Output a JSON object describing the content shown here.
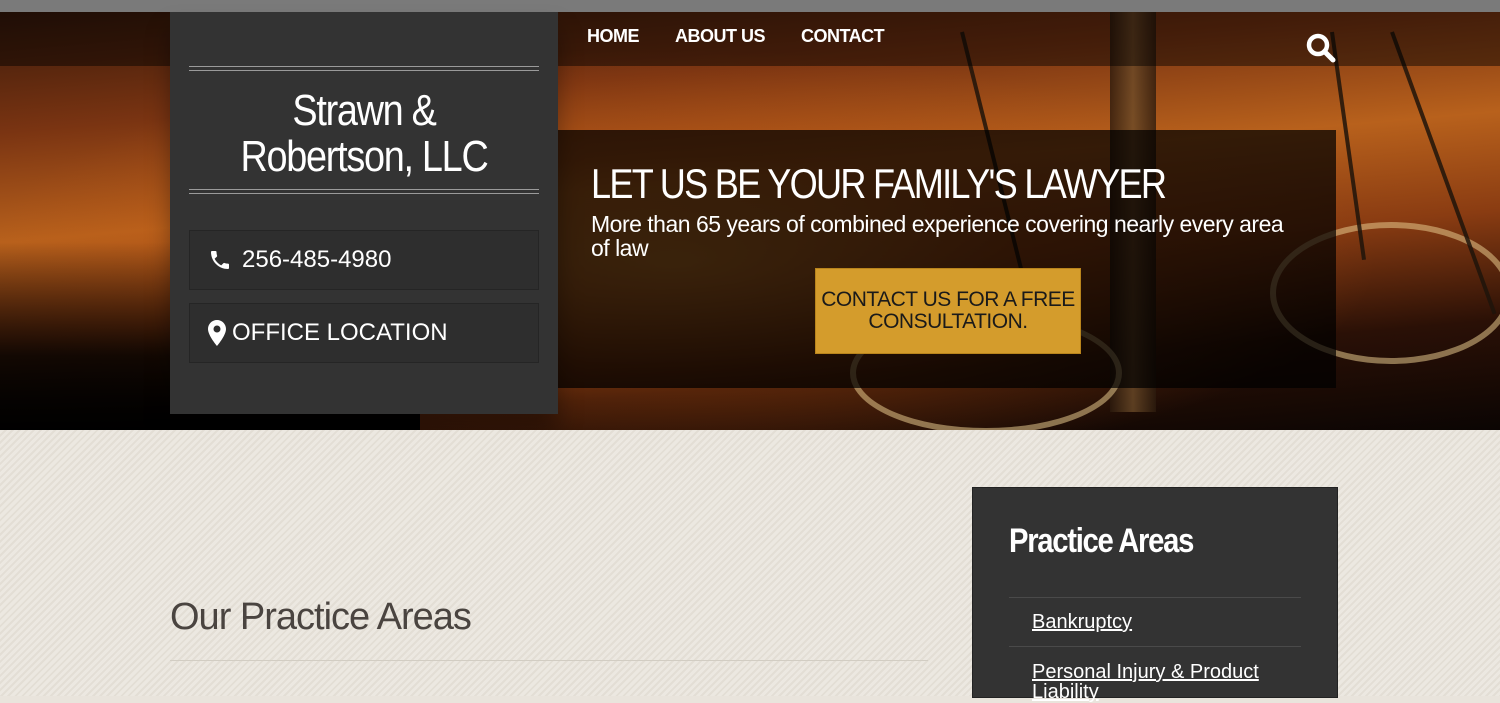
{
  "nav": {
    "items": [
      "HOME",
      "ABOUT US",
      "CONTACT"
    ]
  },
  "brand": {
    "name_line1": "Strawn &",
    "name_line2": "Robertson, LLC",
    "phone": "256-485-4980",
    "location_label": "OFFICE LOCATION"
  },
  "promo": {
    "headline": "LET US BE YOUR FAMILY'S LAWYER",
    "subtext": "More than 65 years of combined experience covering nearly every area of law",
    "cta_label": "CONTACT US FOR A FREE CONSULTATION."
  },
  "main": {
    "section_title": "Our Practice Areas"
  },
  "sidebar": {
    "title": "Practice Areas",
    "links": [
      "Bankruptcy",
      "Personal Injury & Product Liability"
    ]
  },
  "colors": {
    "accent": "#d49c2c",
    "panel": "#333333",
    "page_bg": "#e9e4dc"
  }
}
